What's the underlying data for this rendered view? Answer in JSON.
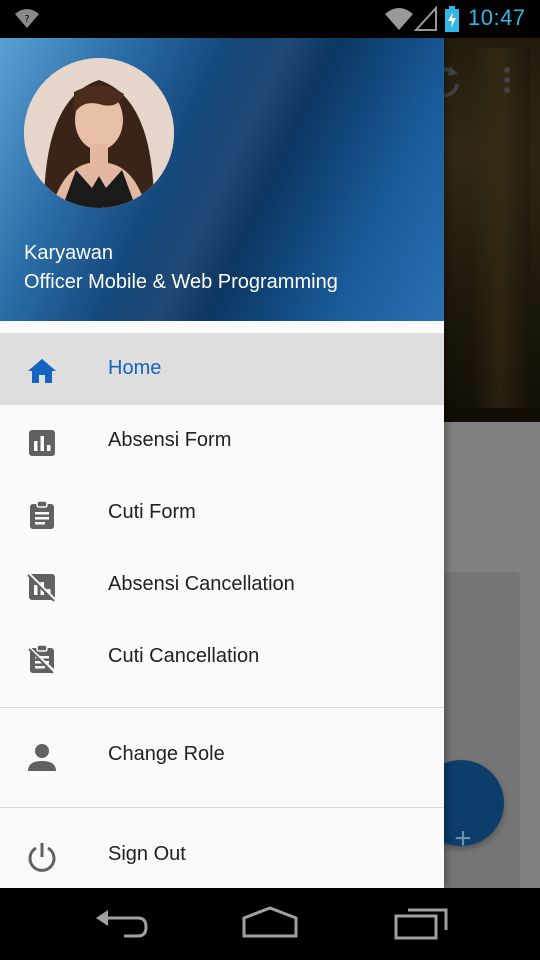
{
  "status_bar": {
    "time": "10:47",
    "icons": [
      "notification-icon",
      "wifi-icon",
      "signal-icon",
      "battery-charging-icon"
    ]
  },
  "drawer": {
    "user_name": "Karyawan",
    "user_role": "Officer Mobile & Web Programming",
    "menu": [
      {
        "label": "Home",
        "icon": "home-icon",
        "selected": true
      },
      {
        "label": "Absensi Form",
        "icon": "bar-chart-icon"
      },
      {
        "label": "Cuti Form",
        "icon": "clipboard-icon"
      },
      {
        "label": "Absensi Cancellation",
        "icon": "bar-chart-cancel-icon"
      },
      {
        "label": "Cuti Cancellation",
        "icon": "clipboard-cancel-icon"
      }
    ],
    "secondary": [
      {
        "label": "Change Role",
        "icon": "person-icon"
      }
    ],
    "footer": [
      {
        "label": "Sign Out",
        "icon": "power-icon"
      }
    ]
  },
  "background_app": {
    "fab_label": "+",
    "actions": [
      "refresh-icon",
      "more-vert-icon"
    ]
  },
  "nav_bar": {
    "buttons": [
      "back-icon",
      "home-nav-icon",
      "recent-apps-icon"
    ]
  },
  "colors": {
    "accent": "#1565c0",
    "selected_bg": "#dedede",
    "header_dark": "#0f3e70",
    "clock": "#33b5e5"
  }
}
